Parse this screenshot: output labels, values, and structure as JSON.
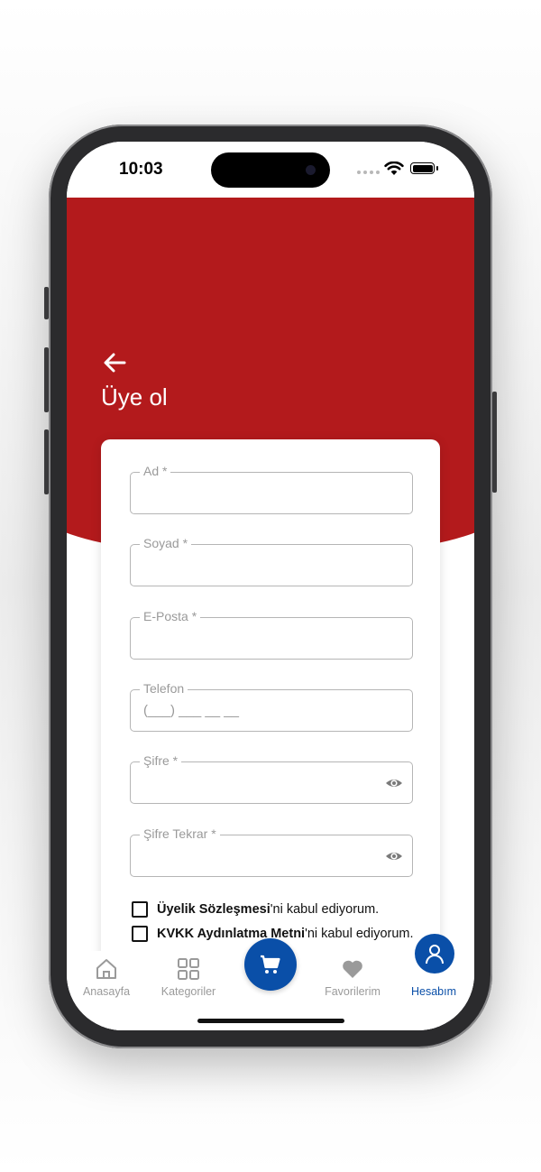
{
  "status_bar": {
    "time": "10:03"
  },
  "header": {
    "title": "Üye ol"
  },
  "form": {
    "fields": [
      {
        "label": "Ad *",
        "value": ""
      },
      {
        "label": "Soyad *",
        "value": ""
      },
      {
        "label": "E-Posta *",
        "value": ""
      },
      {
        "label": "Telefon",
        "value": "(___) ___ __ __"
      },
      {
        "label": "Şifre *",
        "value": ""
      },
      {
        "label": "Şifre Tekrar *",
        "value": ""
      }
    ],
    "checkboxes": [
      {
        "bold": "Üyelik Sözleşmesi",
        "rest": "'ni kabul ediyorum."
      },
      {
        "bold": "KVKK Aydınlatma Metni",
        "rest": "'ni kabul ediyorum."
      }
    ]
  },
  "tab_bar": {
    "tabs": [
      {
        "label": "Anasayfa",
        "icon": "home-icon"
      },
      {
        "label": "Kategoriler",
        "icon": "grid-icon"
      },
      {
        "label": "",
        "icon": "cart-icon"
      },
      {
        "label": "Favorilerim",
        "icon": "heart-icon"
      },
      {
        "label": "Hesabım",
        "icon": "user-icon"
      }
    ],
    "active": "Hesabım"
  },
  "colors": {
    "brand_red": "#b31a1c",
    "brand_blue": "#0a4fa8",
    "inactive_gray": "#9a9a9a"
  }
}
